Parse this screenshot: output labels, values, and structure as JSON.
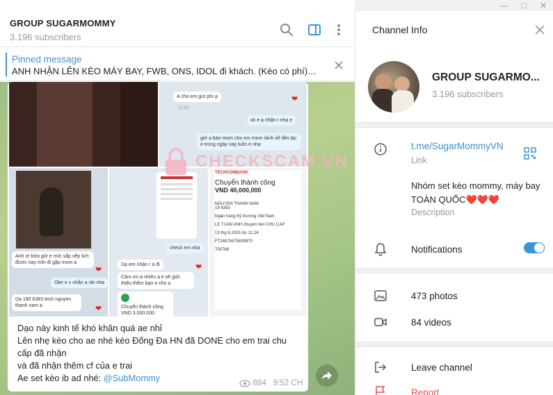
{
  "window": {
    "minimize": "—",
    "maximize": "□",
    "close": "✕"
  },
  "channel": {
    "title": "GROUP SUGARMOMMY",
    "subscribers": "3.196 subscribers"
  },
  "pinned": {
    "title": "Pinned message",
    "text": "ANH NHẬN LÊN KÈO MÁY BAY, FWB, ONS, IDOL đi khách. (Kèo có phí) . ..."
  },
  "watermark": "CHECKSCAM.VN",
  "message": {
    "lines": [
      "Dạo này kinh tế khó khăn quá ae nhỉ",
      "Lên nhẹ kèo cho ae nhé kèo Đống Đa HN đã DONE cho em trai chu",
      "cấp đã nhận",
      "và đã nhận thêm cf của e trai"
    ],
    "last_prefix": "Ae set kèo ib ad nhé: ",
    "mention": "@SubMommy",
    "views": "884",
    "time": "9:52 CH"
  },
  "media": {
    "b_bubbles": [
      "A cho em gửi phí ạ",
      "ok e a nhận r nha e",
      "giờ a báo mom cho em mom rảnh sẽ liên lạc e trong ngày nay luôn e nha",
      "12:33"
    ],
    "c_bubbles": [
      "Anh ơi bữa giờ e mới sắp xếp lịch được nay mới đi gặp mom ạ",
      "Oke e v nhắn a stk nha",
      "Dạ 190 6383 tech nguyen thanh nam ạ"
    ],
    "d_bubbles": [
      "check em nha",
      "Dạ em nhận r a đi",
      "Cảm ơn a nhiều ạ e sẽ giới thiệu thêm bạn e cho a",
      "Chuyển thành công VND 3.000.000"
    ],
    "e_bank": {
      "bank": "TECHCOMBANK",
      "status": "Chuyển thành công",
      "amount": "VND 40,000,000",
      "name": "NGUYEN THANH NAM",
      "account": "19 6383",
      "bank_full": "Ngân hàng Kỹ thương Việt Nam",
      "sender": "LE TUAN ANH chuyen tien CHU CAP",
      "date": "13 thg 6,2025 lúc 21:24",
      "ref": "FT24878475830870",
      "code": "705768"
    }
  },
  "info": {
    "title": "Channel Info",
    "name": "GROUP SUGARMO...",
    "subscribers": "3.196 subscribers",
    "link": "t.me/SugarMommyVN",
    "link_label": "Link",
    "description": "Nhóm set kèo mommy, máy bay TOÀN QUỐC❤️❤️❤️",
    "description_label": "Description",
    "notifications": "Notifications",
    "notifications_on": true,
    "photos": "473 photos",
    "videos": "84 videos",
    "leave": "Leave channel",
    "report": "Report"
  },
  "colors": {
    "accent": "#3a95d6",
    "danger": "#e54d4d"
  }
}
